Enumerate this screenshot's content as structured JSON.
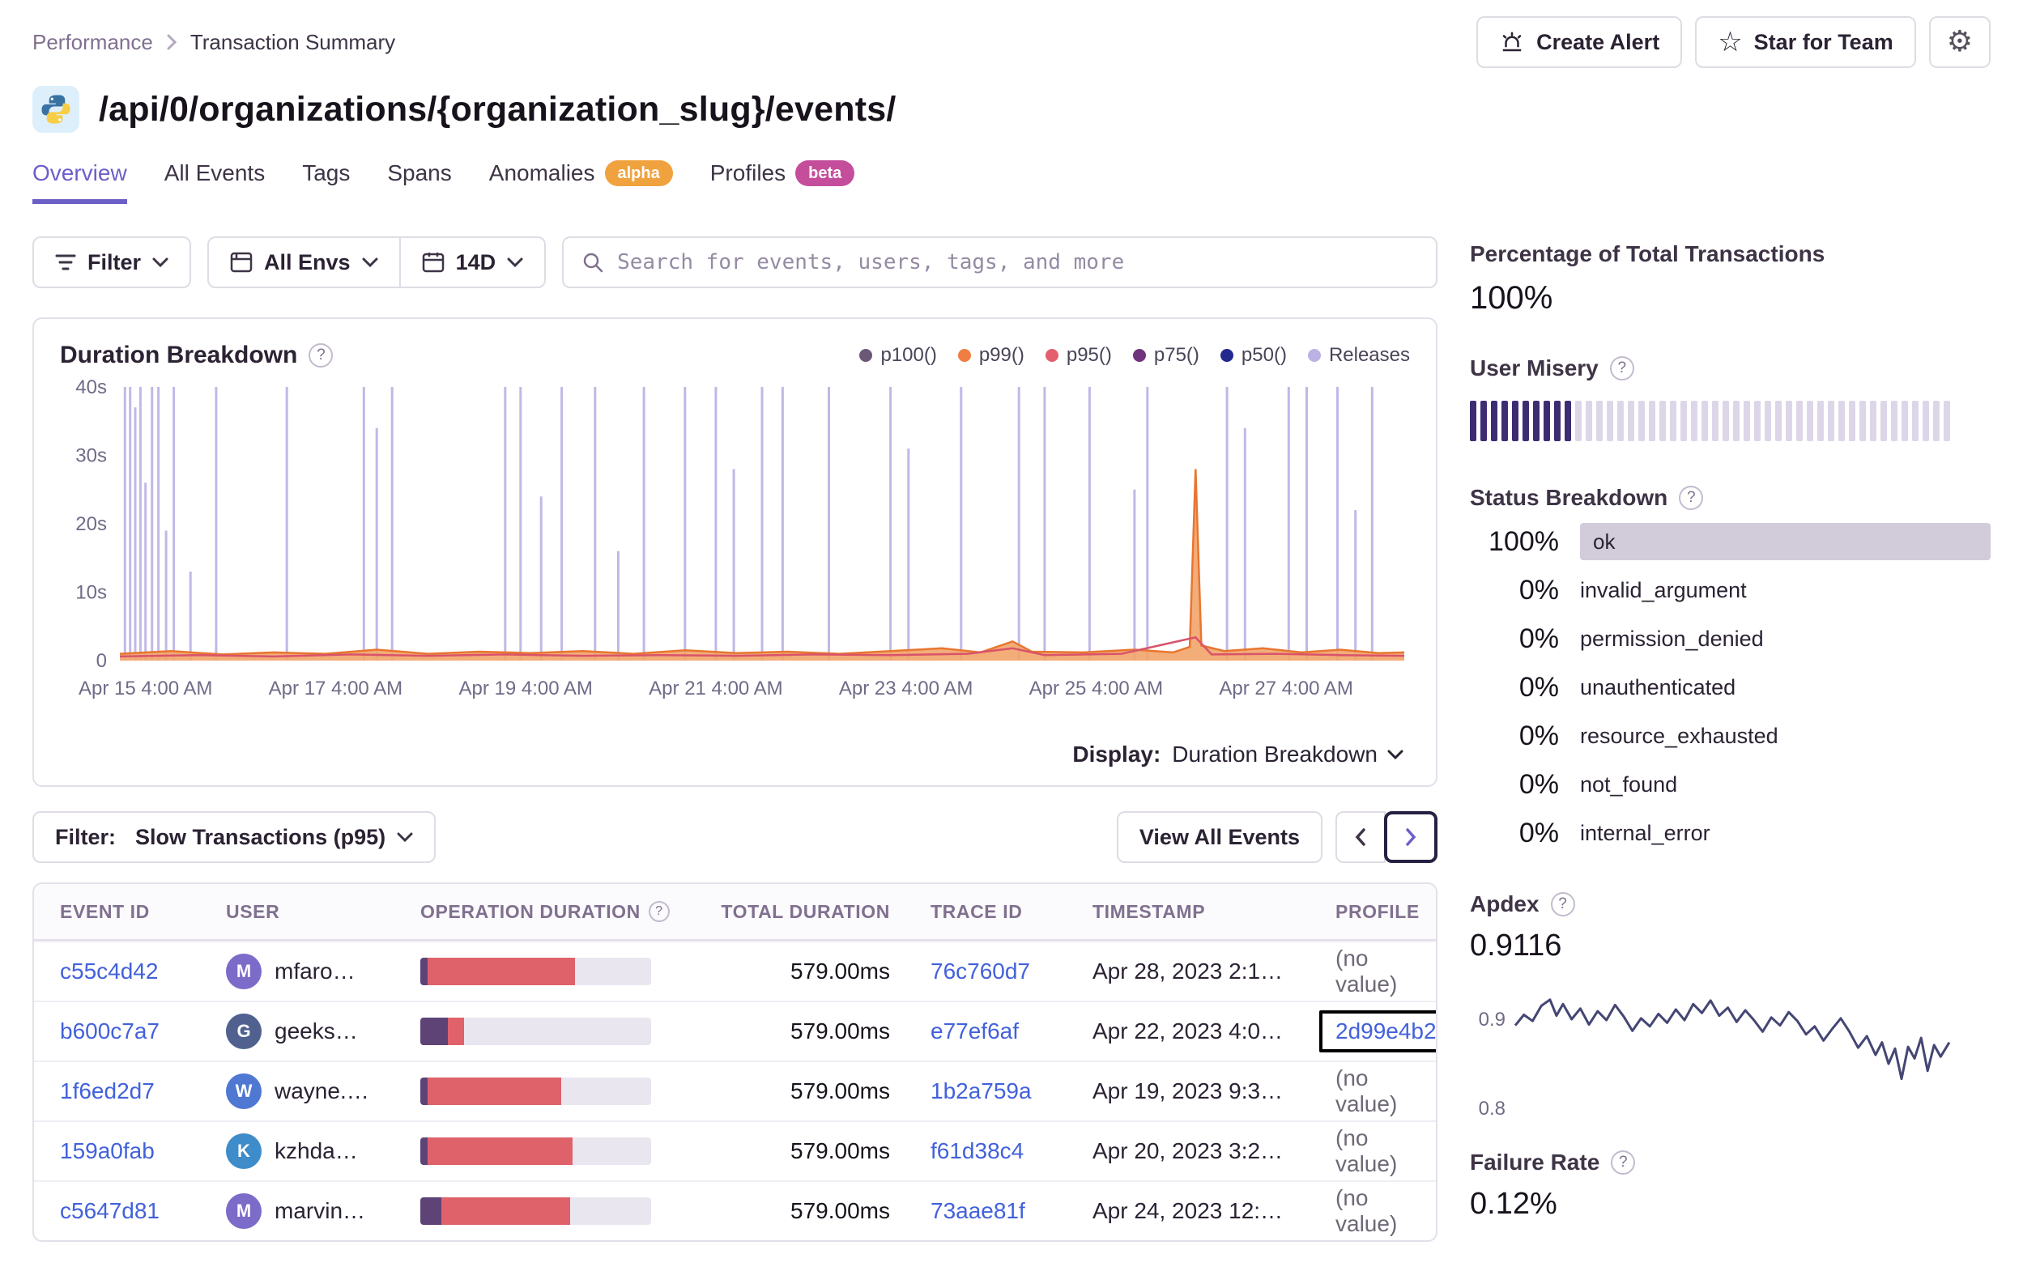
{
  "breadcrumb": {
    "parent": "Performance",
    "current": "Transaction Summary"
  },
  "topbar": {
    "create_alert_label": "Create Alert",
    "star_label": "Star for Team"
  },
  "page": {
    "title": "/api/0/organizations/{organization_slug}/events/"
  },
  "tabs": [
    {
      "label": "Overview",
      "active": true
    },
    {
      "label": "All Events"
    },
    {
      "label": "Tags"
    },
    {
      "label": "Spans"
    },
    {
      "label": "Anomalies",
      "badge": "alpha",
      "badge_color": "#F0A23E"
    },
    {
      "label": "Profiles",
      "badge": "beta",
      "badge_color": "#C54E9C"
    }
  ],
  "filter_bar": {
    "filter_label": "Filter",
    "env_label": "All Envs",
    "range_label": "14D",
    "search_placeholder": "Search for events, users, tags, and more"
  },
  "chart_panel": {
    "title": "Duration Breakdown",
    "display_label": "Display:",
    "display_value": "Duration Breakdown"
  },
  "chart_data": [
    {
      "type": "line",
      "title": "Duration Breakdown",
      "ylabel": "duration",
      "ylim": [
        0,
        40
      ],
      "legend": [
        {
          "label": "p100()",
          "color": "#6B5876"
        },
        {
          "label": "p99()",
          "color": "#EF7E42"
        },
        {
          "label": "p95()",
          "color": "#E35F6E"
        },
        {
          "label": "p75()",
          "color": "#71337B"
        },
        {
          "label": "p50()",
          "color": "#222A8F"
        },
        {
          "label": "Releases",
          "color": "#BCB1E4"
        }
      ],
      "y_ticks": [
        {
          "value": 0,
          "label": "0"
        },
        {
          "value": 10,
          "label": "10s"
        },
        {
          "value": 20,
          "label": "20s"
        },
        {
          "value": 30,
          "label": "30s"
        },
        {
          "value": 40,
          "label": "40s"
        }
      ],
      "x_ticks": [
        {
          "frac": 0.02,
          "label": "Apr 15 4:00 AM"
        },
        {
          "frac": 0.168,
          "label": "Apr 17 4:00 AM"
        },
        {
          "frac": 0.316,
          "label": "Apr 19 4:00 AM"
        },
        {
          "frac": 0.464,
          "label": "Apr 21 4:00 AM"
        },
        {
          "frac": 0.612,
          "label": "Apr 23 4:00 AM"
        },
        {
          "frac": 0.76,
          "label": "Apr 25 4:00 AM"
        },
        {
          "frac": 0.908,
          "label": "Apr 27 4:00 AM"
        }
      ],
      "spike_color": "#8F7FD4",
      "release_spikes": [
        [
          0.004,
          40
        ],
        [
          0.008,
          40
        ],
        [
          0.012,
          37
        ],
        [
          0.016,
          40
        ],
        [
          0.02,
          26
        ],
        [
          0.025,
          40
        ],
        [
          0.03,
          40
        ],
        [
          0.036,
          19
        ],
        [
          0.042,
          40
        ],
        [
          0.055,
          13
        ],
        [
          0.075,
          40
        ],
        [
          0.13,
          40
        ],
        [
          0.19,
          40
        ],
        [
          0.2,
          34
        ],
        [
          0.212,
          40
        ],
        [
          0.3,
          40
        ],
        [
          0.312,
          40
        ],
        [
          0.328,
          24
        ],
        [
          0.344,
          40
        ],
        [
          0.37,
          40
        ],
        [
          0.388,
          16
        ],
        [
          0.408,
          40
        ],
        [
          0.44,
          40
        ],
        [
          0.464,
          40
        ],
        [
          0.478,
          28
        ],
        [
          0.5,
          40
        ],
        [
          0.516,
          40
        ],
        [
          0.552,
          40
        ],
        [
          0.6,
          40
        ],
        [
          0.614,
          31
        ],
        [
          0.655,
          40
        ],
        [
          0.7,
          40
        ],
        [
          0.72,
          40
        ],
        [
          0.755,
          40
        ],
        [
          0.79,
          25
        ],
        [
          0.8,
          40
        ],
        [
          0.862,
          40
        ],
        [
          0.876,
          34
        ],
        [
          0.91,
          40
        ],
        [
          0.924,
          40
        ],
        [
          0.948,
          40
        ],
        [
          0.962,
          22
        ],
        [
          0.975,
          40
        ]
      ],
      "p99_fill": "#F2A469",
      "p99_stroke": "#E8762F",
      "p99_area": [
        [
          0,
          1.0
        ],
        [
          0.04,
          1.4
        ],
        [
          0.08,
          0.9
        ],
        [
          0.12,
          1.2
        ],
        [
          0.16,
          1.0
        ],
        [
          0.2,
          1.6
        ],
        [
          0.24,
          1.0
        ],
        [
          0.28,
          1.3
        ],
        [
          0.32,
          1.1
        ],
        [
          0.36,
          1.4
        ],
        [
          0.4,
          1.0
        ],
        [
          0.44,
          1.5
        ],
        [
          0.48,
          1.1
        ],
        [
          0.52,
          1.3
        ],
        [
          0.56,
          1.0
        ],
        [
          0.6,
          1.4
        ],
        [
          0.64,
          1.8
        ],
        [
          0.67,
          1.2
        ],
        [
          0.695,
          2.8
        ],
        [
          0.71,
          1.3
        ],
        [
          0.75,
          1.2
        ],
        [
          0.79,
          1.6
        ],
        [
          0.82,
          1.2
        ],
        [
          0.833,
          2.0
        ],
        [
          0.8375,
          28.0
        ],
        [
          0.842,
          2.2
        ],
        [
          0.86,
          1.4
        ],
        [
          0.89,
          1.8
        ],
        [
          0.92,
          1.2
        ],
        [
          0.95,
          1.6
        ],
        [
          0.98,
          1.1
        ],
        [
          1,
          1.2
        ]
      ],
      "p95_color": "#D9536B",
      "p95_line": [
        [
          0,
          0.6
        ],
        [
          0.06,
          0.8
        ],
        [
          0.12,
          0.6
        ],
        [
          0.18,
          0.9
        ],
        [
          0.24,
          0.7
        ],
        [
          0.3,
          0.9
        ],
        [
          0.36,
          0.7
        ],
        [
          0.42,
          0.8
        ],
        [
          0.48,
          0.7
        ],
        [
          0.54,
          0.9
        ],
        [
          0.6,
          0.8
        ],
        [
          0.66,
          1.0
        ],
        [
          0.695,
          1.8
        ],
        [
          0.72,
          0.8
        ],
        [
          0.78,
          1.0
        ],
        [
          0.8375,
          3.4
        ],
        [
          0.85,
          0.9
        ],
        [
          0.9,
          1.0
        ],
        [
          0.95,
          0.8
        ],
        [
          1,
          0.7
        ]
      ]
    },
    {
      "type": "line",
      "title": "Apdex sparkline",
      "ylim": [
        0.79,
        0.95
      ],
      "y_ticks": [
        {
          "value": 0.9,
          "label": "0.9"
        },
        {
          "value": 0.8,
          "label": "0.8"
        }
      ],
      "color": "#444674",
      "points": [
        [
          0,
          0.893
        ],
        [
          0.02,
          0.905
        ],
        [
          0.04,
          0.898
        ],
        [
          0.06,
          0.915
        ],
        [
          0.08,
          0.922
        ],
        [
          0.095,
          0.904
        ],
        [
          0.11,
          0.917
        ],
        [
          0.13,
          0.9
        ],
        [
          0.15,
          0.912
        ],
        [
          0.17,
          0.894
        ],
        [
          0.19,
          0.909
        ],
        [
          0.21,
          0.899
        ],
        [
          0.23,
          0.916
        ],
        [
          0.25,
          0.903
        ],
        [
          0.27,
          0.887
        ],
        [
          0.29,
          0.901
        ],
        [
          0.31,
          0.892
        ],
        [
          0.33,
          0.906
        ],
        [
          0.35,
          0.896
        ],
        [
          0.37,
          0.911
        ],
        [
          0.39,
          0.899
        ],
        [
          0.41,
          0.917
        ],
        [
          0.43,
          0.907
        ],
        [
          0.45,
          0.921
        ],
        [
          0.47,
          0.904
        ],
        [
          0.49,
          0.913
        ],
        [
          0.51,
          0.897
        ],
        [
          0.53,
          0.91
        ],
        [
          0.55,
          0.899
        ],
        [
          0.57,
          0.886
        ],
        [
          0.59,
          0.902
        ],
        [
          0.61,
          0.893
        ],
        [
          0.63,
          0.908
        ],
        [
          0.65,
          0.898
        ],
        [
          0.67,
          0.883
        ],
        [
          0.69,
          0.892
        ],
        [
          0.71,
          0.876
        ],
        [
          0.73,
          0.889
        ],
        [
          0.75,
          0.901
        ],
        [
          0.77,
          0.886
        ],
        [
          0.79,
          0.868
        ],
        [
          0.81,
          0.881
        ],
        [
          0.83,
          0.86
        ],
        [
          0.845,
          0.874
        ],
        [
          0.86,
          0.85
        ],
        [
          0.875,
          0.867
        ],
        [
          0.89,
          0.833
        ],
        [
          0.905,
          0.869
        ],
        [
          0.92,
          0.856
        ],
        [
          0.935,
          0.879
        ],
        [
          0.95,
          0.842
        ],
        [
          0.965,
          0.871
        ],
        [
          0.98,
          0.858
        ],
        [
          1,
          0.874
        ]
      ]
    }
  ],
  "list_controls": {
    "filter_label": "Filter:",
    "filter_value": "Slow Transactions (p95)",
    "view_all_label": "View All Events"
  },
  "table": {
    "columns": [
      "EVENT ID",
      "USER",
      "OPERATION DURATION",
      "TOTAL DURATION",
      "TRACE ID",
      "TIMESTAMP",
      "PROFILE"
    ],
    "rows": [
      {
        "event_id": "c55c4d42",
        "user_initial": "M",
        "user": "mfaro…",
        "avatar_color": "#7C6BC8",
        "op_bar": {
          "purple_pct": 3,
          "red_pct": 64
        },
        "total": "579.00ms",
        "trace_id": "76c760d7",
        "timestamp": "Apr 28, 2023 2:1…",
        "profile": "(no value)"
      },
      {
        "event_id": "b600c7a7",
        "user_initial": "G",
        "user": "geeks…",
        "avatar_color": "#50618F",
        "op_bar": {
          "purple_pct": 12,
          "red_pct": 7
        },
        "total": "579.00ms",
        "trace_id": "e77ef6af",
        "timestamp": "Apr 22, 2023 4:0…",
        "profile": "2d99e4b2"
      },
      {
        "event_id": "1f6ed2d7",
        "user_initial": "W",
        "user": "wayne.…",
        "avatar_color": "#4F78D2",
        "op_bar": {
          "purple_pct": 3,
          "red_pct": 58
        },
        "total": "579.00ms",
        "trace_id": "1b2a759a",
        "timestamp": "Apr 19, 2023 9:3…",
        "profile": "(no value)"
      },
      {
        "event_id": "159a0fab",
        "user_initial": "K",
        "user": "kzhda…",
        "avatar_color": "#3E8CC9",
        "op_bar": {
          "purple_pct": 3,
          "red_pct": 63
        },
        "total": "579.00ms",
        "trace_id": "f61d38c4",
        "timestamp": "Apr 20, 2023 3:2…",
        "profile": "(no value)"
      },
      {
        "event_id": "c5647d81",
        "user_initial": "M",
        "user": "marvin…",
        "avatar_color": "#7C6BC8",
        "op_bar": {
          "purple_pct": 9,
          "red_pct": 56
        },
        "total": "579.00ms",
        "trace_id": "73aae81f",
        "timestamp": "Apr 24, 2023 12:…",
        "profile": "(no value)"
      }
    ]
  },
  "sidebar": {
    "pct_total": {
      "heading": "Percentage of Total Transactions",
      "value": "100%"
    },
    "user_misery": {
      "heading": "User Misery",
      "total_bars": 46,
      "filled_bars": 10,
      "filled_color": "#3E2C73",
      "empty_color": "#DDD6E8"
    },
    "status_breakdown": {
      "heading": "Status Breakdown",
      "rows": [
        {
          "pct": "100%",
          "label": "ok",
          "bar": true
        },
        {
          "pct": "0%",
          "label": "invalid_argument"
        },
        {
          "pct": "0%",
          "label": "permission_denied"
        },
        {
          "pct": "0%",
          "label": "unauthenticated"
        },
        {
          "pct": "0%",
          "label": "resource_exhausted"
        },
        {
          "pct": "0%",
          "label": "not_found"
        },
        {
          "pct": "0%",
          "label": "internal_error"
        }
      ]
    },
    "apdex": {
      "heading": "Apdex",
      "value": "0.9116"
    },
    "failure_rate": {
      "heading": "Failure Rate",
      "value": "0.12%"
    }
  }
}
